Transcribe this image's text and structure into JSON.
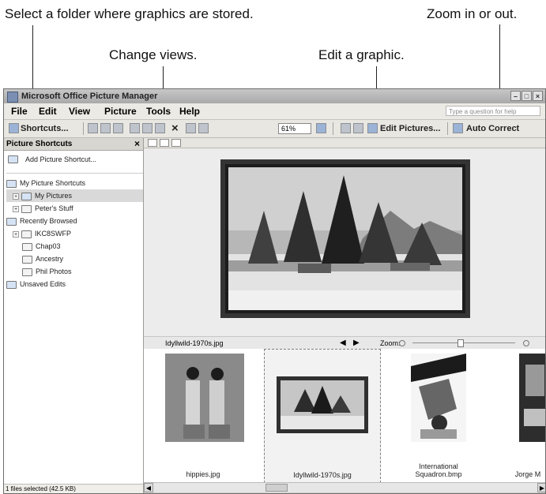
{
  "annotations": {
    "select_folder": "Select a folder where graphics are stored.",
    "zoom": "Zoom in or out.",
    "change_views": "Change views.",
    "edit_graphic": "Edit a graphic."
  },
  "window": {
    "title": "Microsoft Office Picture Manager",
    "help_placeholder": "Type a question for help"
  },
  "menu": [
    "File",
    "Edit",
    "View",
    "Picture",
    "Tools",
    "Help"
  ],
  "toolbar": {
    "shortcuts": "Shortcuts...",
    "zoom_value": "61%",
    "edit_pictures": "Edit Pictures...",
    "auto_correct": "Auto Correct"
  },
  "pane": {
    "title": "Picture Shortcuts",
    "close": "×",
    "add": "Add Picture Shortcut...",
    "tree": [
      {
        "label": "My Picture Shortcuts"
      },
      {
        "label": "My Pictures"
      },
      {
        "label": "Peter's Stuff"
      },
      {
        "label": "Recently Browsed"
      },
      {
        "label": "IKC8SWFP"
      },
      {
        "label": "Chap03"
      },
      {
        "label": "Ancestry"
      },
      {
        "label": "Phil Photos"
      },
      {
        "label": "Unsaved Edits"
      }
    ]
  },
  "status": "1 files selected (42.5 KB)",
  "film": {
    "current_file": "Idyllwild-1970s.jpg",
    "zoom_label": "Zoom:"
  },
  "thumbnails": [
    {
      "name": "hippies.jpg"
    },
    {
      "name": "Idyllwild-1970s.jpg"
    },
    {
      "name": "International Squadron.bmp"
    },
    {
      "name": "Jorge M"
    }
  ],
  "colors": {
    "window_bg": "#d4d0c8",
    "accent_blue": "#9bb3d6"
  }
}
